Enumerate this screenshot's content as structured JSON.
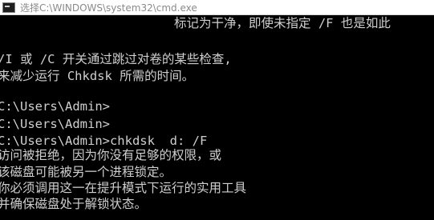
{
  "window": {
    "title": "选择C:\\WINDOWS\\system32\\cmd.exe",
    "icon": "cmd-icon",
    "colors": {
      "background": "#000000",
      "text": "#cfcfcf",
      "titlebar": "#ffffff",
      "title_text": "#8a8a8a"
    }
  },
  "console": {
    "lines": [
      "标记为干净，即使未指定 /F 也是如此",
      "",
      "/I 或 /C 开关通过跳过对卷的某些检查,",
      "来减少运行 Chkdsk 所需的时间。",
      "",
      "C:\\Users\\Admin>",
      "C:\\Users\\Admin>",
      "C:\\Users\\Admin>chkdsk  d: /F",
      "访问被拒绝，因为你没有足够的权限，或",
      "该磁盘可能被另一个进程锁定。",
      "你必须调用这一在提升模式下运行的实用工具",
      "并确保磁盘处于解锁状态。"
    ]
  }
}
